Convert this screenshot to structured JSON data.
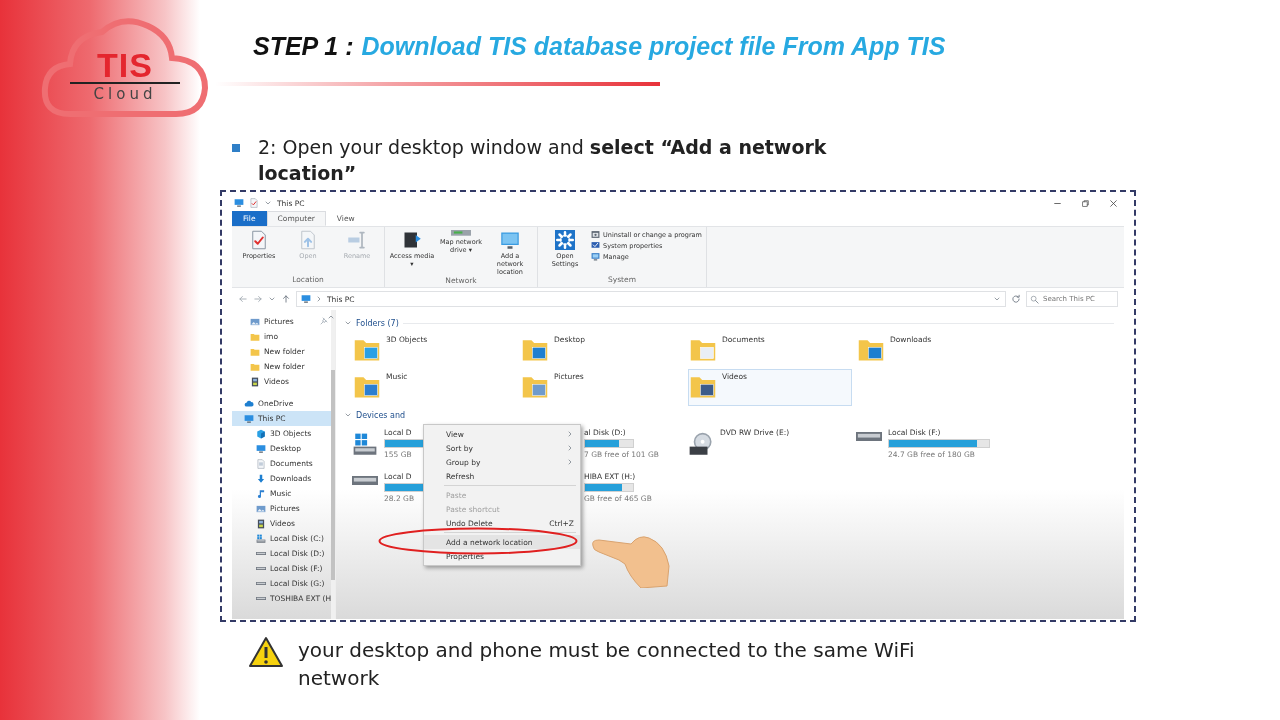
{
  "logo": {
    "brand": "TIS",
    "subtitle": "Cloud"
  },
  "title": {
    "prefix": "STEP 1 :",
    "text": "Download TIS database project file From App TIS"
  },
  "instruction": "2: Open your desktop window and  **select “Add a network location”**",
  "explorer": {
    "title": "This PC",
    "ribbon_tabs": [
      {
        "label": "File",
        "kind": "file",
        "selected": false
      },
      {
        "label": "Computer",
        "kind": "tab",
        "selected": true
      },
      {
        "label": "View",
        "kind": "tab",
        "selected": false
      }
    ],
    "ribbon_groups": [
      {
        "label": "Location",
        "buttons": [
          {
            "label": "Properties",
            "kind": "properties",
            "disabled": false
          },
          {
            "label": "Open",
            "kind": "open",
            "disabled": true
          },
          {
            "label": "Rename",
            "kind": "rename",
            "disabled": true
          }
        ]
      },
      {
        "label": "Network",
        "buttons": [
          {
            "label": "Access media ▾",
            "kind": "media",
            "disabled": false
          },
          {
            "label": "Map network drive ▾",
            "kind": "mapdrive",
            "disabled": false
          },
          {
            "label": "Add a network location",
            "kind": "netloc",
            "disabled": false
          }
        ]
      },
      {
        "label": "System",
        "buttons": [
          {
            "label": "Open Settings",
            "kind": "settings",
            "disabled": false
          }
        ],
        "links": [
          {
            "label": "Uninstall or change a program",
            "kind": "uninstall"
          },
          {
            "label": "System properties",
            "kind": "sysprops"
          },
          {
            "label": "Manage",
            "kind": "manage"
          }
        ]
      }
    ],
    "address": "This PC",
    "search": {
      "placeholder": "Search This PC"
    },
    "nav_items": [
      {
        "label": "Pictures",
        "kind": "picture",
        "pinned": true,
        "selected": false
      },
      {
        "label": "imo",
        "kind": "folder",
        "pinned": false,
        "selected": false
      },
      {
        "label": "New folder",
        "kind": "folder",
        "pinned": false,
        "selected": false
      },
      {
        "label": "New folder",
        "kind": "folder",
        "pinned": false,
        "selected": false
      },
      {
        "label": "Videos",
        "kind": "film",
        "pinned": false,
        "selected": false
      },
      {
        "label": "OneDrive",
        "kind": "cloud",
        "pinned": false,
        "selected": false
      },
      {
        "label": "This PC",
        "kind": "pc",
        "pinned": false,
        "selected": true,
        "children": [
          {
            "label": "3D Objects",
            "kind": "cube",
            "selected": false
          },
          {
            "label": "Desktop",
            "kind": "pc",
            "selected": false
          },
          {
            "label": "Documents",
            "kind": "document",
            "selected": false
          },
          {
            "label": "Downloads",
            "kind": "download",
            "selected": false
          },
          {
            "label": "Music",
            "kind": "music",
            "selected": false
          },
          {
            "label": "Pictures",
            "kind": "picture",
            "selected": false
          },
          {
            "label": "Videos",
            "kind": "film",
            "selected": false
          },
          {
            "label": "Local Disk (C:)",
            "kind": "drivewin",
            "selected": false
          },
          {
            "label": "Local Disk (D:)",
            "kind": "drive",
            "selected": false
          },
          {
            "label": "Local Disk (F:)",
            "kind": "drive",
            "selected": false
          },
          {
            "label": "Local Disk (G:)",
            "kind": "drive",
            "selected": false
          },
          {
            "label": "TOSHIBA EXT (H",
            "kind": "drive",
            "selected": false
          }
        ]
      }
    ],
    "folders_heading": "Folders (7)",
    "folders": [
      {
        "name": "3D Objects",
        "kind": "cube",
        "selected": false
      },
      {
        "name": "Desktop",
        "kind": "pc",
        "selected": false
      },
      {
        "name": "Documents",
        "kind": "document",
        "selected": false
      },
      {
        "name": "Downloads",
        "kind": "download",
        "selected": false
      },
      {
        "name": "Music",
        "kind": "music",
        "selected": false
      },
      {
        "name": "Pictures",
        "kind": "picture",
        "selected": false
      },
      {
        "name": "Videos",
        "kind": "film",
        "selected": true
      }
    ],
    "drives_heading": "Devices and",
    "drives": [
      {
        "name": "Local D",
        "detail": "155 GB",
        "kind": "drivewin",
        "level": 0.75
      },
      {
        "name": "al Disk (D:)",
        "detail": "7 GB free of 101 GB",
        "kind": "covered",
        "level": 0.7
      },
      {
        "name": "DVD RW Drive (E:)",
        "kind": "dvd"
      },
      {
        "name": "Local Disk (F:)",
        "detail": "24.7 GB free of 180 GB",
        "kind": "drive",
        "level": 0.88
      },
      {
        "name": "Local D",
        "detail": "28.2 GB",
        "kind": "drive",
        "level": 0.8
      },
      {
        "name": "HIBA EXT (H:)",
        "detail": "GB free of 465 GB",
        "kind": "covered",
        "level": 0.78
      }
    ],
    "context_menu": [
      {
        "label": "View",
        "kind": "submenu",
        "disabled": false,
        "selected": false
      },
      {
        "label": "Sort by",
        "kind": "submenu",
        "disabled": false,
        "selected": false
      },
      {
        "label": "Group by",
        "kind": "submenu",
        "disabled": false,
        "selected": false
      },
      {
        "label": "Refresh",
        "kind": "item",
        "disabled": false,
        "selected": false
      },
      {
        "kind": "separator"
      },
      {
        "label": "Paste",
        "kind": "item",
        "disabled": true,
        "selected": false
      },
      {
        "label": "Paste shortcut",
        "kind": "item",
        "disabled": true,
        "selected": false
      },
      {
        "label": "Undo Delete",
        "kind": "item",
        "shortcut": "Ctrl+Z",
        "disabled": false,
        "selected": false
      },
      {
        "kind": "separator"
      },
      {
        "label": "Add a network location",
        "kind": "item",
        "disabled": false,
        "selected": true
      },
      {
        "label": "Properties",
        "kind": "item",
        "disabled": false,
        "selected": false
      }
    ]
  },
  "warning": "your desktop and phone must be connected to the same WiFi network"
}
